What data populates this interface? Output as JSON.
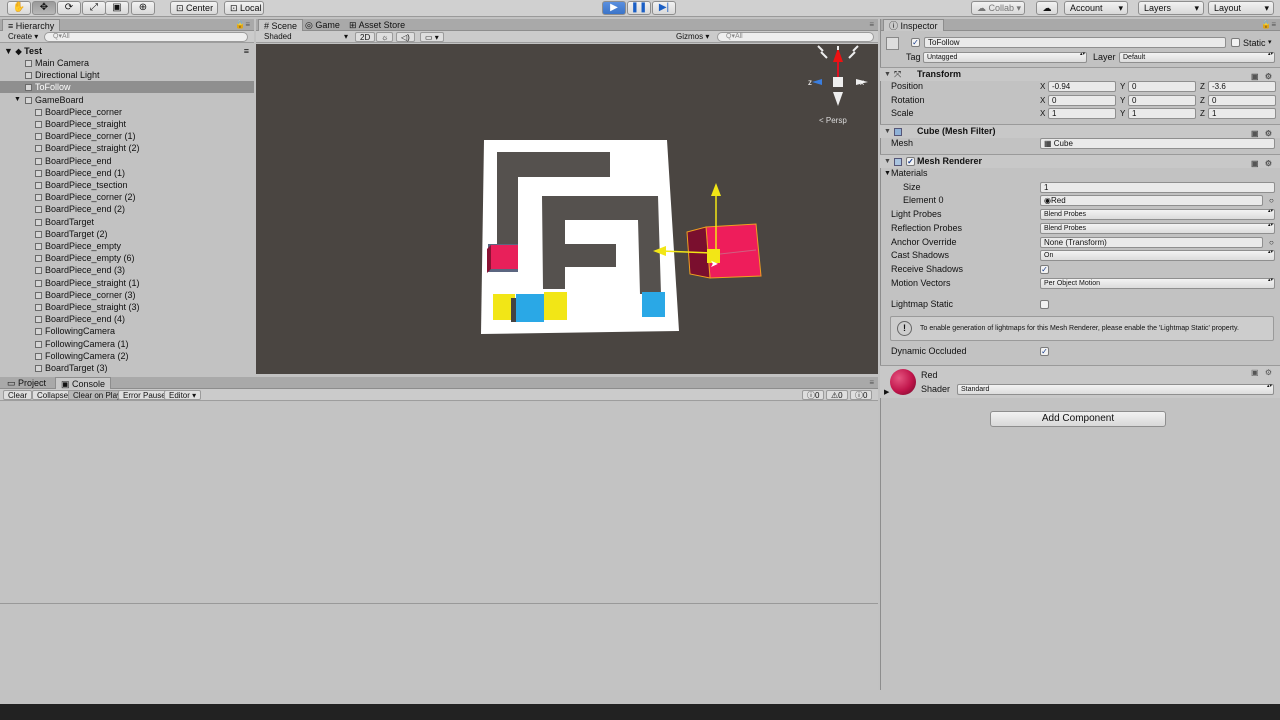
{
  "toolbar": {
    "tools": [
      "hand-icon",
      "move-icon",
      "rotate-icon",
      "scale-icon",
      "rect-icon"
    ],
    "pivot": "Center",
    "space": "Local",
    "collab": "Collab ▾",
    "account": "Account",
    "layers": "Layers",
    "layout": "Layout"
  },
  "hierarchy": {
    "tab": "Hierarchy",
    "create": "Create",
    "search": "Q▾All",
    "scene": "Test",
    "items": [
      {
        "label": "Main Camera",
        "indent": 1
      },
      {
        "label": "Directional Light",
        "indent": 1
      },
      {
        "label": "ToFollow",
        "indent": 1,
        "selected": true
      },
      {
        "label": "GameBoard",
        "indent": 1,
        "expanded": true
      },
      {
        "label": "BoardPiece_corner",
        "indent": 2
      },
      {
        "label": "BoardPiece_straight",
        "indent": 2
      },
      {
        "label": "BoardPiece_corner (1)",
        "indent": 2
      },
      {
        "label": "BoardPiece_straight (2)",
        "indent": 2
      },
      {
        "label": "BoardPiece_end",
        "indent": 2
      },
      {
        "label": "BoardPiece_end (1)",
        "indent": 2
      },
      {
        "label": "BoardPiece_tsection",
        "indent": 2
      },
      {
        "label": "BoardPiece_corner (2)",
        "indent": 2
      },
      {
        "label": "BoardPiece_end (2)",
        "indent": 2
      },
      {
        "label": "BoardTarget",
        "indent": 2
      },
      {
        "label": "BoardTarget (2)",
        "indent": 2
      },
      {
        "label": "BoardPiece_empty",
        "indent": 2
      },
      {
        "label": "BoardPiece_empty (6)",
        "indent": 2
      },
      {
        "label": "BoardPiece_end (3)",
        "indent": 2
      },
      {
        "label": "BoardPiece_straight (1)",
        "indent": 2
      },
      {
        "label": "BoardPiece_corner (3)",
        "indent": 2
      },
      {
        "label": "BoardPiece_straight (3)",
        "indent": 2
      },
      {
        "label": "BoardPiece_end (4)",
        "indent": 2
      },
      {
        "label": "FollowingCamera",
        "indent": 2
      },
      {
        "label": "FollowingCamera (1)",
        "indent": 2
      },
      {
        "label": "FollowingCamera (2)",
        "indent": 2
      },
      {
        "label": "BoardTarget (3)",
        "indent": 2
      }
    ]
  },
  "scene": {
    "tabs": [
      "Scene",
      "Game",
      "Asset Store"
    ],
    "shading": "Shaded",
    "mode_2d": "2D",
    "gizmos": "Gizmos",
    "search": "Q▾All",
    "persp": "< Persp",
    "colors": {
      "background": "#4a4541",
      "board": "#ffffff",
      "red": "#e8205a",
      "yellow": "#f2e616",
      "blue": "#2aa8e6"
    }
  },
  "console": {
    "tabs": [
      "Project",
      "Console"
    ],
    "buttons": [
      "Clear",
      "Collapse",
      "Clear on Play",
      "Error Pause",
      "Editor"
    ],
    "counts": [
      "0",
      "0",
      "0"
    ]
  },
  "inspector": {
    "tab": "Inspector",
    "object_name": "ToFollow",
    "static_label": "Static",
    "tag_label": "Tag",
    "tag": "Untagged",
    "layer_label": "Layer",
    "layer": "Default",
    "transform": {
      "title": "Transform",
      "position_label": "Position",
      "rotation_label": "Rotation",
      "scale_label": "Scale",
      "position": {
        "x": "-0.94",
        "y": "0",
        "z": "-3.6"
      },
      "rotation": {
        "x": "0",
        "y": "0",
        "z": "0"
      },
      "scale": {
        "x": "1",
        "y": "1",
        "z": "1"
      }
    },
    "mesh_filter": {
      "title": "Cube (Mesh Filter)",
      "mesh_label": "Mesh",
      "mesh": "Cube"
    },
    "mesh_renderer": {
      "title": "Mesh Renderer",
      "materials_label": "Materials",
      "size_label": "Size",
      "size": "1",
      "element0_label": "Element 0",
      "element0": "Red",
      "light_probes_label": "Light Probes",
      "light_probes": "Blend Probes",
      "reflection_probes_label": "Reflection Probes",
      "reflection_probes": "Blend Probes",
      "anchor_override_label": "Anchor Override",
      "anchor_override": "None (Transform)",
      "cast_shadows_label": "Cast Shadows",
      "cast_shadows": "On",
      "receive_shadows_label": "Receive Shadows",
      "motion_vectors_label": "Motion Vectors",
      "motion_vectors": "Per Object Motion",
      "lightmap_static_label": "Lightmap Static",
      "info": "To enable generation of lightmaps for this Mesh Renderer, please enable the 'Lightmap Static' property.",
      "dynamic_occluded_label": "Dynamic Occluded"
    },
    "material": {
      "name": "Red",
      "shader_label": "Shader",
      "shader": "Standard",
      "color": "#c0144a"
    },
    "add_component": "Add Component"
  }
}
